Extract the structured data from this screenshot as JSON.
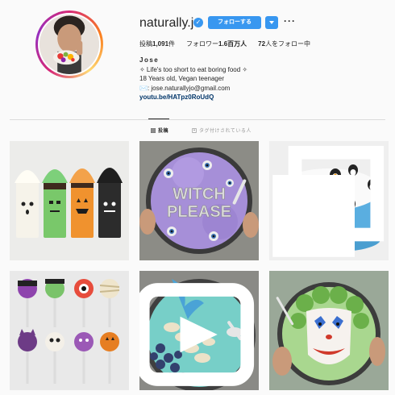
{
  "profile": {
    "username": "naturally.jo",
    "follow_label": "フォローする",
    "more_label": "···",
    "stats": {
      "posts_label": "投稿",
      "posts_count": "1,091",
      "posts_unit": "件",
      "followers_label": "フォロワー",
      "followers_count": "1.6百万人",
      "following_count": "72",
      "following_label": "人をフォロー中"
    },
    "bio": {
      "name": "Jose",
      "line1": "✧ Life's too short to eat boring food ✧",
      "line2": "18 Years old, Vegan teenager",
      "line3": "✉️: jose.naturallyjo@gmail.com",
      "link": "youtu.be/HATpz0RoUdQ"
    }
  },
  "tabs": {
    "posts": "投稿",
    "tagged": "タグ付けされている人"
  },
  "colors": {
    "accent": "#3897f0",
    "link": "#003569",
    "divider": "#dbdbdb"
  },
  "posts": [
    {
      "id": "ghost-shakes",
      "icon": "multiple-images-icon",
      "multi": false
    },
    {
      "id": "witch-please-bowl",
      "icon": "",
      "multi": false
    },
    {
      "id": "penguin-cake",
      "icon": "multiple-images-icon",
      "multi": true
    },
    {
      "id": "halloween-cake-pops",
      "icon": "",
      "multi": false
    },
    {
      "id": "mermaid-smoothie-bowl",
      "icon": "video-icon",
      "multi": true
    },
    {
      "id": "joker-smoothie-bowl",
      "icon": "",
      "multi": false
    }
  ],
  "tile_text": {
    "witch_line1": "WITCH",
    "witch_line2": "PLEASE"
  }
}
